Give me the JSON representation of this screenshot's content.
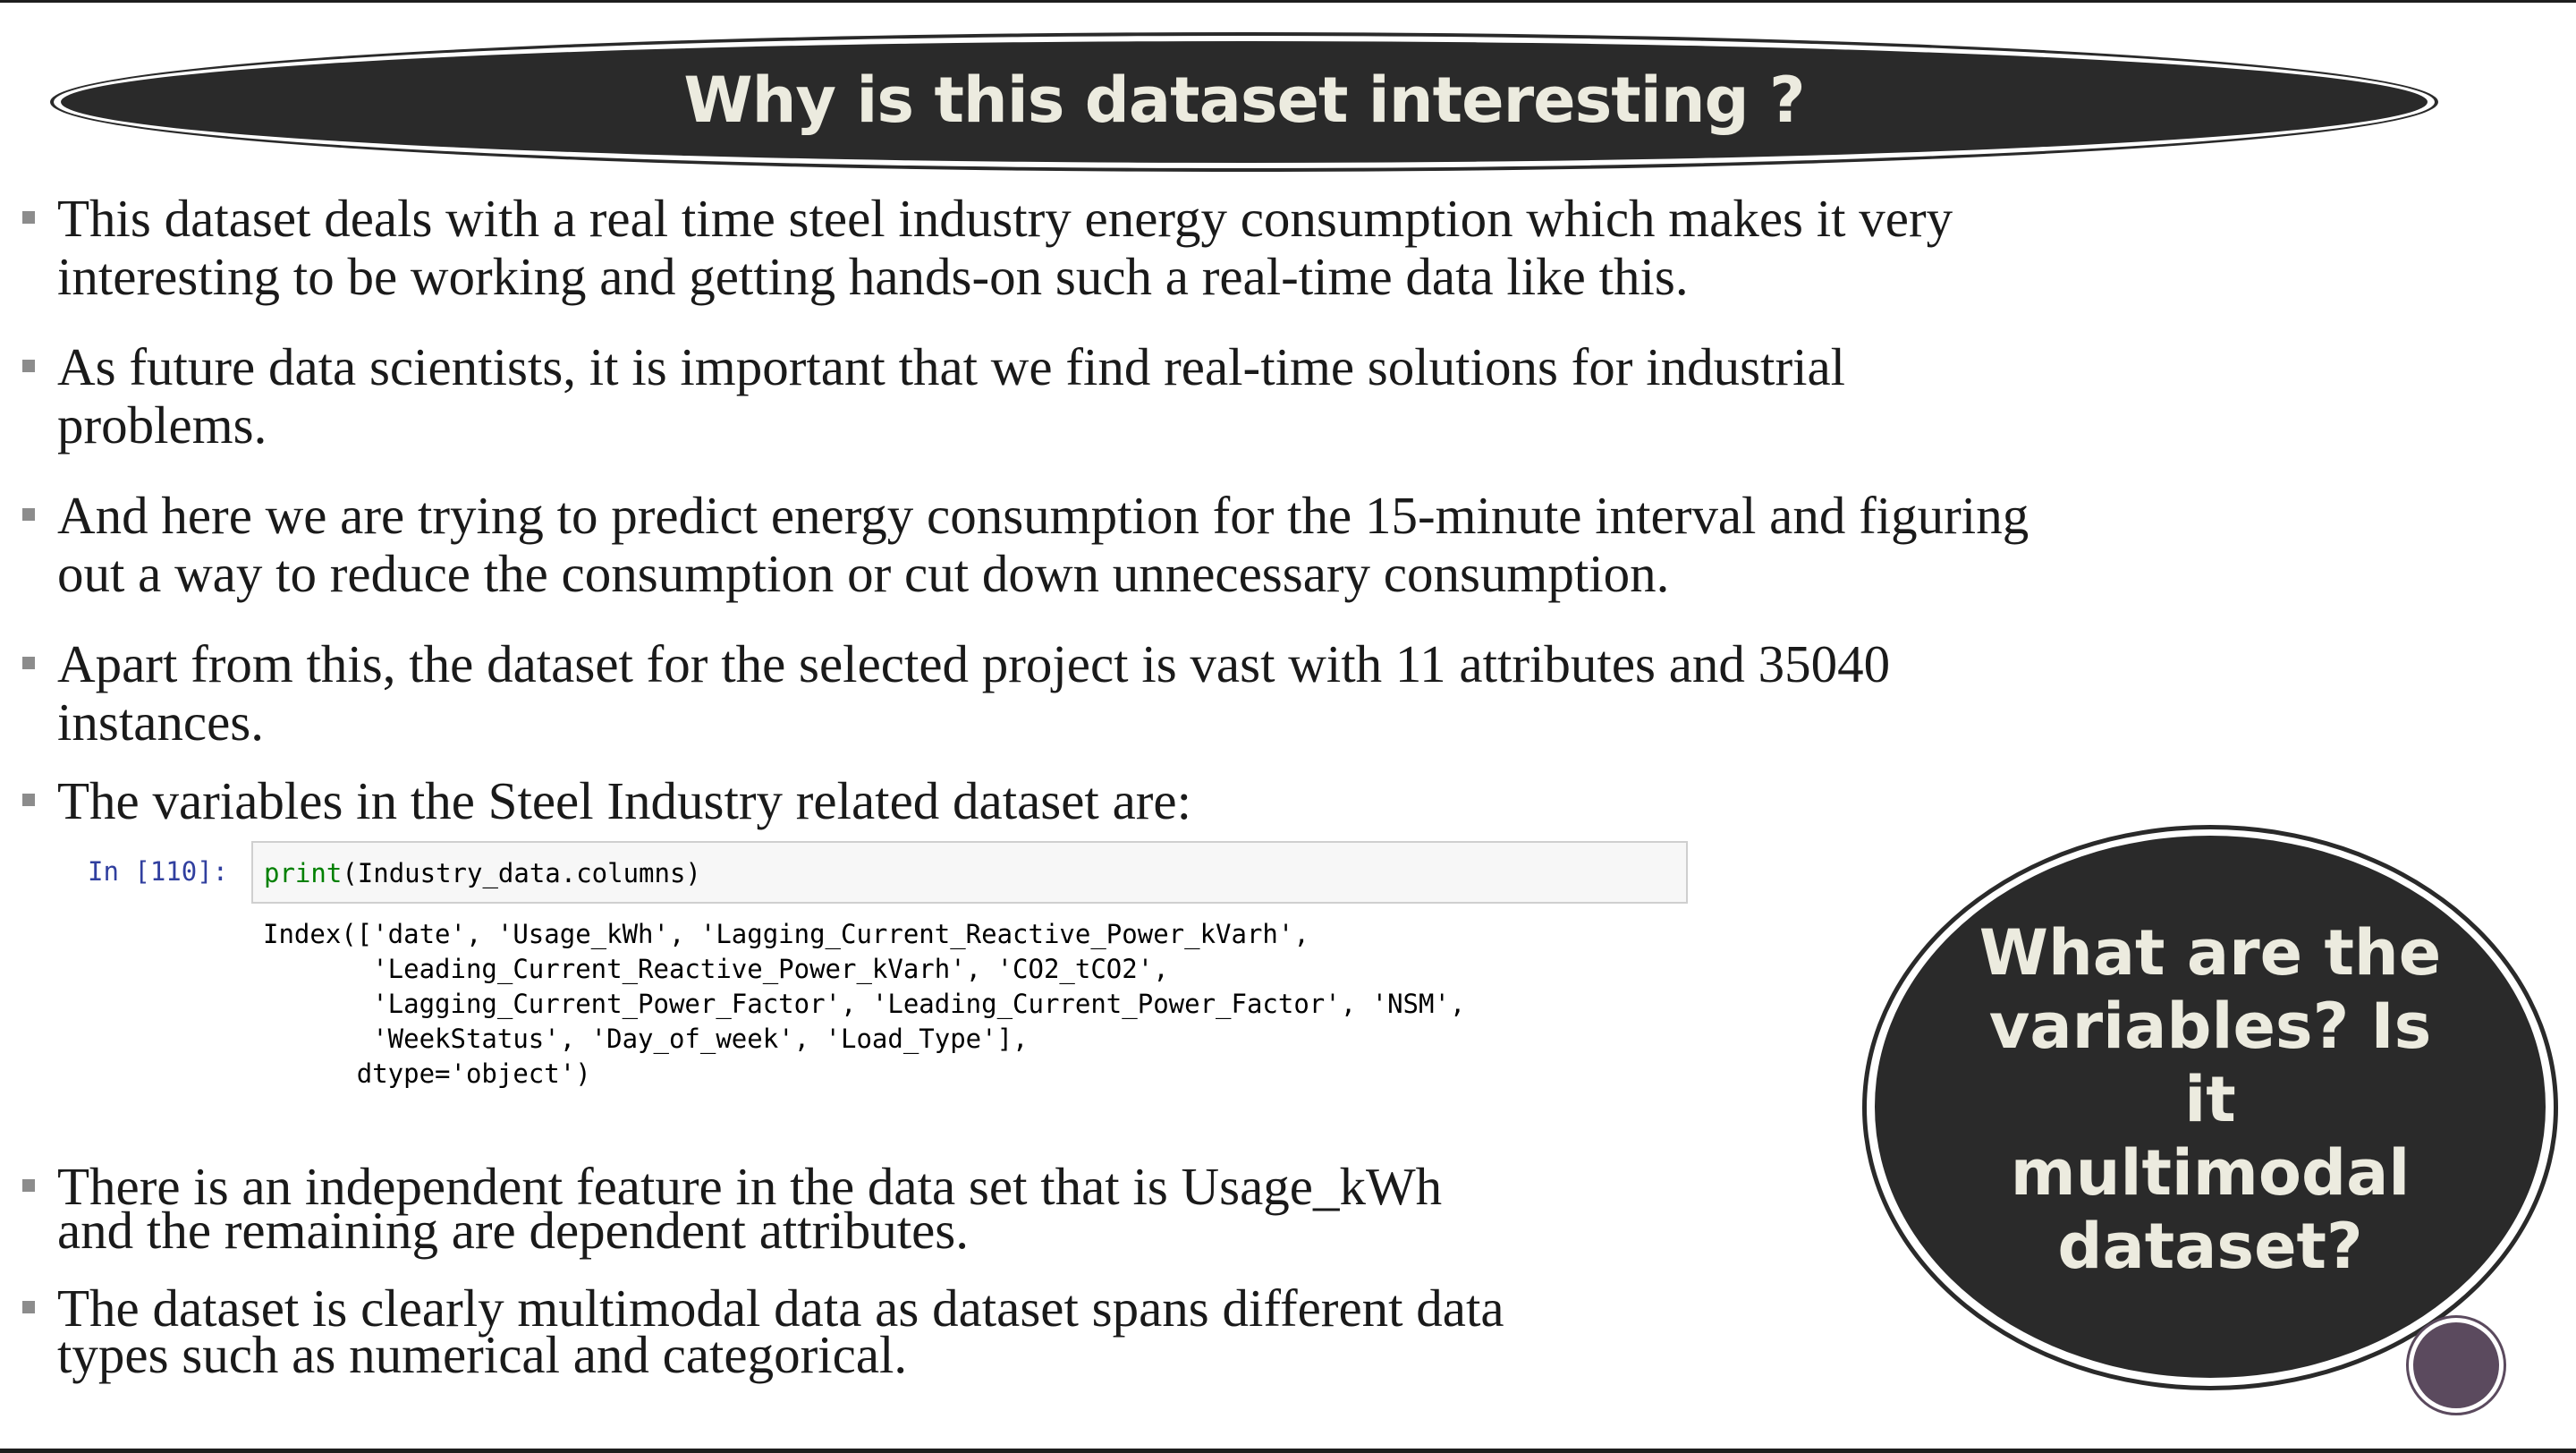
{
  "slide": {
    "title": "Why is this dataset interesting ?",
    "bullets": [
      {
        "lines": [
          "This dataset deals with a real time steel industry energy consumption which makes it very",
          "interesting to be working and getting hands-on such a real-time data like this."
        ]
      },
      {
        "lines": [
          "As future data scientists, it is important that we find real-time solutions for industrial",
          "problems."
        ]
      },
      {
        "lines": [
          "And here we are trying to predict energy consumption for the 15-minute interval and figuring",
          "out a way to reduce the consumption or cut down unnecessary consumption."
        ]
      },
      {
        "lines": [
          "Apart from this, the dataset for the selected project is vast with 11 attributes and 35040",
          "instances."
        ]
      },
      {
        "lines": [
          "The variables in the Steel Industry related dataset are:"
        ]
      },
      {
        "lines": [
          "There is an independent feature in the data set that is Usage_kWh",
          "and the remaining are dependent attributes."
        ]
      },
      {
        "lines": [
          "The dataset is clearly multimodal data as dataset spans different data",
          "types such as numerical and categorical."
        ]
      }
    ],
    "code": {
      "prompt": "In [110]:",
      "input_keyword": "print",
      "input_rest": "(Industry_data.columns)",
      "output": "Index(['date', 'Usage_kWh', 'Lagging_Current_Reactive_Power_kVarh',\n       'Leading_Current_Reactive_Power_kVarh', 'CO2_tCO2',\n       'Lagging_Current_Power_Factor', 'Leading_Current_Power_Factor', 'NSM',\n       'WeekStatus', 'Day_of_week', 'Load_Type'],\n      dtype='object')"
    },
    "callout": "What are the\nvariables? Is\nit multimodal\ndataset?",
    "colors": {
      "dark_fill": "#2a2a2a",
      "light_text": "#ecebdf",
      "bullet_marker": "#8c8c8c",
      "accent_disc": "#5b4a5e"
    }
  }
}
